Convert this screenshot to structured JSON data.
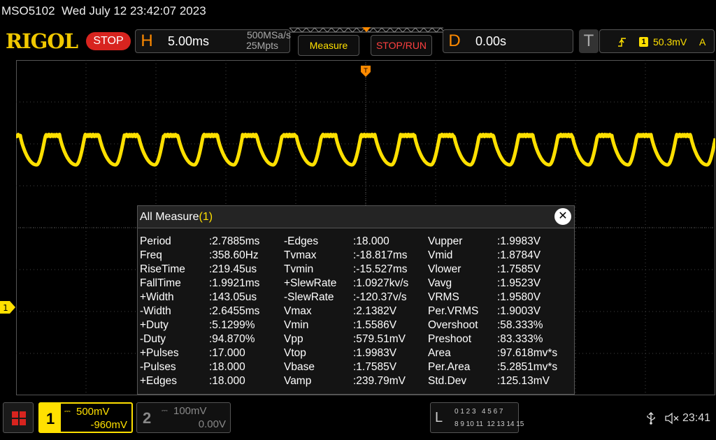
{
  "header": {
    "model": "MSO5102",
    "datetime": "Wed July 12 23:42:07 2023"
  },
  "topbar": {
    "logo": "RIGOL",
    "run_state": "STOP",
    "horizontal": {
      "letter": "H",
      "timebase": "5.00ms",
      "sample_rate": "500MSa/s",
      "memory_depth": "25Mpts"
    },
    "measure_button": "Measure",
    "stop_run_button": "STOP/RUN",
    "delay": {
      "letter": "D",
      "value": "0.00s"
    },
    "trigger": {
      "letter": "T",
      "source": "1",
      "level": "50.3mV",
      "mode": "A"
    }
  },
  "markers": {
    "ch1_label": "1"
  },
  "measure_panel": {
    "title": "All Measure",
    "count": "(1)",
    "columns": [
      [
        {
          "label": "Period",
          "value": ":2.7885ms"
        },
        {
          "label": "Freq",
          "value": ":358.60Hz"
        },
        {
          "label": "RiseTime",
          "value": ":219.45us"
        },
        {
          "label": "FallTime",
          "value": ":1.9921ms"
        },
        {
          "label": "+Width",
          "value": ":143.05us"
        },
        {
          "label": "-Width",
          "value": ":2.6455ms"
        },
        {
          "label": "+Duty",
          "value": ":5.1299%"
        },
        {
          "label": "-Duty",
          "value": ":94.870%"
        },
        {
          "label": "+Pulses",
          "value": ":17.000"
        },
        {
          "label": "-Pulses",
          "value": ":18.000"
        },
        {
          "label": "+Edges",
          "value": ":18.000"
        }
      ],
      [
        {
          "label": "-Edges",
          "value": ":18.000"
        },
        {
          "label": "Tvmax",
          "value": ":-18.817ms"
        },
        {
          "label": "Tvmin",
          "value": ":-15.527ms"
        },
        {
          "label": "+SlewRate",
          "value": ":1.0927kv/s"
        },
        {
          "label": "-SlewRate",
          "value": ":-120.37v/s"
        },
        {
          "label": "Vmax",
          "value": ":2.1382V"
        },
        {
          "label": "Vmin",
          "value": ":1.5586V"
        },
        {
          "label": "Vpp",
          "value": ":579.51mV"
        },
        {
          "label": "Vtop",
          "value": ":1.9983V"
        },
        {
          "label": "Vbase",
          "value": ":1.7585V"
        },
        {
          "label": "Vamp",
          "value": ":239.79mV"
        }
      ],
      [
        {
          "label": "Vupper",
          "value": ":1.9983V"
        },
        {
          "label": "Vmid",
          "value": ":1.8784V"
        },
        {
          "label": "Vlower",
          "value": ":1.7585V"
        },
        {
          "label": "Vavg",
          "value": ":1.9523V"
        },
        {
          "label": "VRMS",
          "value": ":1.9580V"
        },
        {
          "label": "Per.VRMS",
          "value": ":1.9003V"
        },
        {
          "label": "Overshoot",
          "value": ":58.333%"
        },
        {
          "label": "Preshoot",
          "value": ":83.333%"
        },
        {
          "label": "Area",
          "value": ":97.618mv*s"
        },
        {
          "label": "Per.Area",
          "value": ":5.2851mv*s"
        },
        {
          "label": "Std.Dev",
          "value": ":125.13mV"
        }
      ]
    ]
  },
  "bottombar": {
    "ch1": {
      "number": "1",
      "scale": "500mV",
      "offset": "-960mV"
    },
    "ch2": {
      "number": "2",
      "scale": "100mV",
      "offset": "0.00V"
    },
    "logic": {
      "letter": "L",
      "row1": "0 1 2 3   4 5 6 7",
      "row2": "8 9 10 11  12 13 14 15"
    },
    "clock": "23:41"
  },
  "colors": {
    "ch1": "#ffe000",
    "logo": "#f0c800",
    "accent_orange": "#ff8a00",
    "stop_red": "#d8241f"
  },
  "icons": [
    "menu-grid-icon",
    "usb-icon",
    "speaker-mute-icon",
    "trigger-rising-edge-icon",
    "close-icon"
  ]
}
